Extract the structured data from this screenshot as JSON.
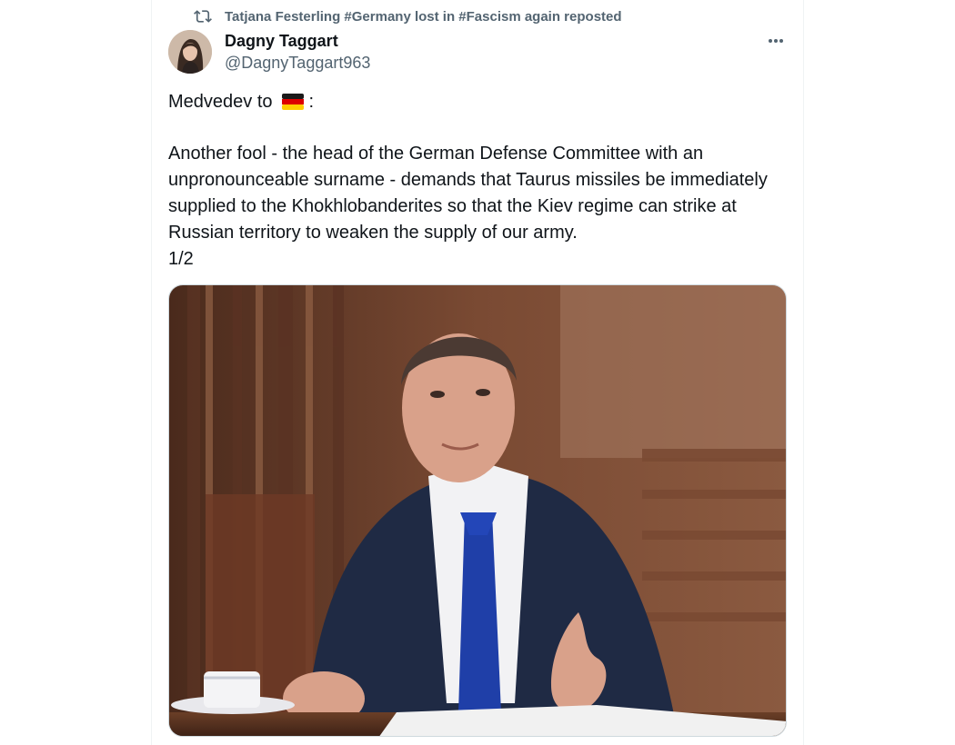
{
  "repost": {
    "text": "Tatjana Festerling #Germany lost in #Fascism again reposted",
    "icon": "repost-icon"
  },
  "author": {
    "name": "Dagny Taggart",
    "handle": "@DagnyTaggart963"
  },
  "tweet": {
    "line1_prefix": "Medvedev to",
    "line1_suffix": ":",
    "flag_icon": "germany-flag-icon",
    "body": "Another fool - the head of the German Defense Committee with an unpronounceable surname - demands that Taurus missiles be immediately supplied to the Khokhlobanderites so that the Kiev regime can strike at Russian territory to weaken the supply of our army.",
    "counter": "1/2"
  },
  "colors": {
    "text": "#0f1419",
    "secondary": "#536471",
    "border": "#eff3f4"
  }
}
